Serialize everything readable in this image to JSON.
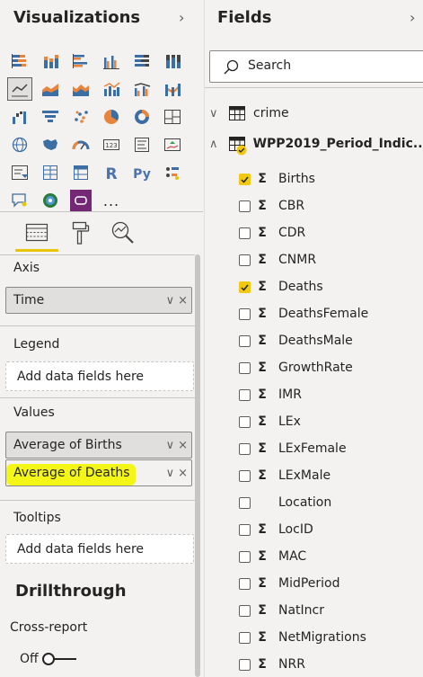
{
  "visualizations": {
    "title": "Visualizations",
    "chevron": "›",
    "more_label": "...",
    "icons": [
      [
        "stacked-bar-chart-icon",
        "stacked-column-chart-icon",
        "clustered-bar-chart-icon",
        "clustered-column-chart-icon",
        "100-percent-stacked-bar-icon",
        "100-percent-stacked-column-icon"
      ],
      [
        "line-chart-icon",
        "area-chart-icon",
        "stacked-area-chart-icon",
        "line-and-stacked-column-icon",
        "line-and-clustered-column-icon",
        "ribbon-chart-icon"
      ],
      [
        "waterfall-chart-icon",
        "funnel-chart-icon",
        "scatter-chart-icon",
        "pie-chart-icon",
        "donut-chart-icon",
        "treemap-icon"
      ],
      [
        "map-icon",
        "filled-map-icon",
        "gauge-icon",
        "card-icon",
        "multi-row-card-icon",
        "kpi-icon"
      ],
      [
        "slicer-icon",
        "table-icon",
        "matrix-icon",
        "r-visual-icon",
        "python-visual-icon",
        "key-influencers-icon"
      ],
      [
        "qna-icon",
        "arcgis-map-icon",
        "power-apps-icon",
        "more-visuals-icon"
      ]
    ],
    "selected_icon": "line-chart-icon",
    "tabs": [
      "fields-tab-icon",
      "format-tab-icon",
      "analytics-tab-icon"
    ],
    "active_tab": "fields-tab-icon"
  },
  "wells": {
    "axis": {
      "label": "Axis",
      "fields": [
        "Time"
      ]
    },
    "legend": {
      "label": "Legend",
      "placeholder": "Add data fields here"
    },
    "values": {
      "label": "Values",
      "fields": [
        "Average of Births",
        "Average of Deaths"
      ]
    },
    "tooltips": {
      "label": "Tooltips",
      "placeholder": "Add data fields here"
    },
    "chevron": "∨",
    "remove": "×"
  },
  "drillthrough": {
    "title": "Drillthrough",
    "cross_report_label": "Cross-report",
    "toggle_state": "Off"
  },
  "fields": {
    "title": "Fields",
    "chevron": "›",
    "search_placeholder": "Search",
    "sigma": "Σ",
    "tables": [
      {
        "name": "crime",
        "expanded": false,
        "chevron": "∨"
      },
      {
        "name": "WPP2019_Period_Indic...",
        "expanded": true,
        "chevron": "∧"
      }
    ],
    "items": [
      {
        "name": "Births",
        "checked": true,
        "sigma": true
      },
      {
        "name": "CBR",
        "checked": false,
        "sigma": true
      },
      {
        "name": "CDR",
        "checked": false,
        "sigma": true
      },
      {
        "name": "CNMR",
        "checked": false,
        "sigma": true
      },
      {
        "name": "Deaths",
        "checked": true,
        "sigma": true
      },
      {
        "name": "DeathsFemale",
        "checked": false,
        "sigma": true
      },
      {
        "name": "DeathsMale",
        "checked": false,
        "sigma": true
      },
      {
        "name": "GrowthRate",
        "checked": false,
        "sigma": true
      },
      {
        "name": "IMR",
        "checked": false,
        "sigma": true
      },
      {
        "name": "LEx",
        "checked": false,
        "sigma": true
      },
      {
        "name": "LExFemale",
        "checked": false,
        "sigma": true
      },
      {
        "name": "LExMale",
        "checked": false,
        "sigma": true
      },
      {
        "name": "Location",
        "checked": false,
        "sigma": false
      },
      {
        "name": "LocID",
        "checked": false,
        "sigma": true
      },
      {
        "name": "MAC",
        "checked": false,
        "sigma": true
      },
      {
        "name": "MidPeriod",
        "checked": false,
        "sigma": true
      },
      {
        "name": "NatIncr",
        "checked": false,
        "sigma": true
      },
      {
        "name": "NetMigrations",
        "checked": false,
        "sigma": true
      },
      {
        "name": "NRR",
        "checked": false,
        "sigma": true
      }
    ]
  },
  "colors": {
    "accent_yellow": "#f2c811",
    "highlight": "#f4f600",
    "pane_bg": "#f3f2f1",
    "text": "#252423"
  }
}
